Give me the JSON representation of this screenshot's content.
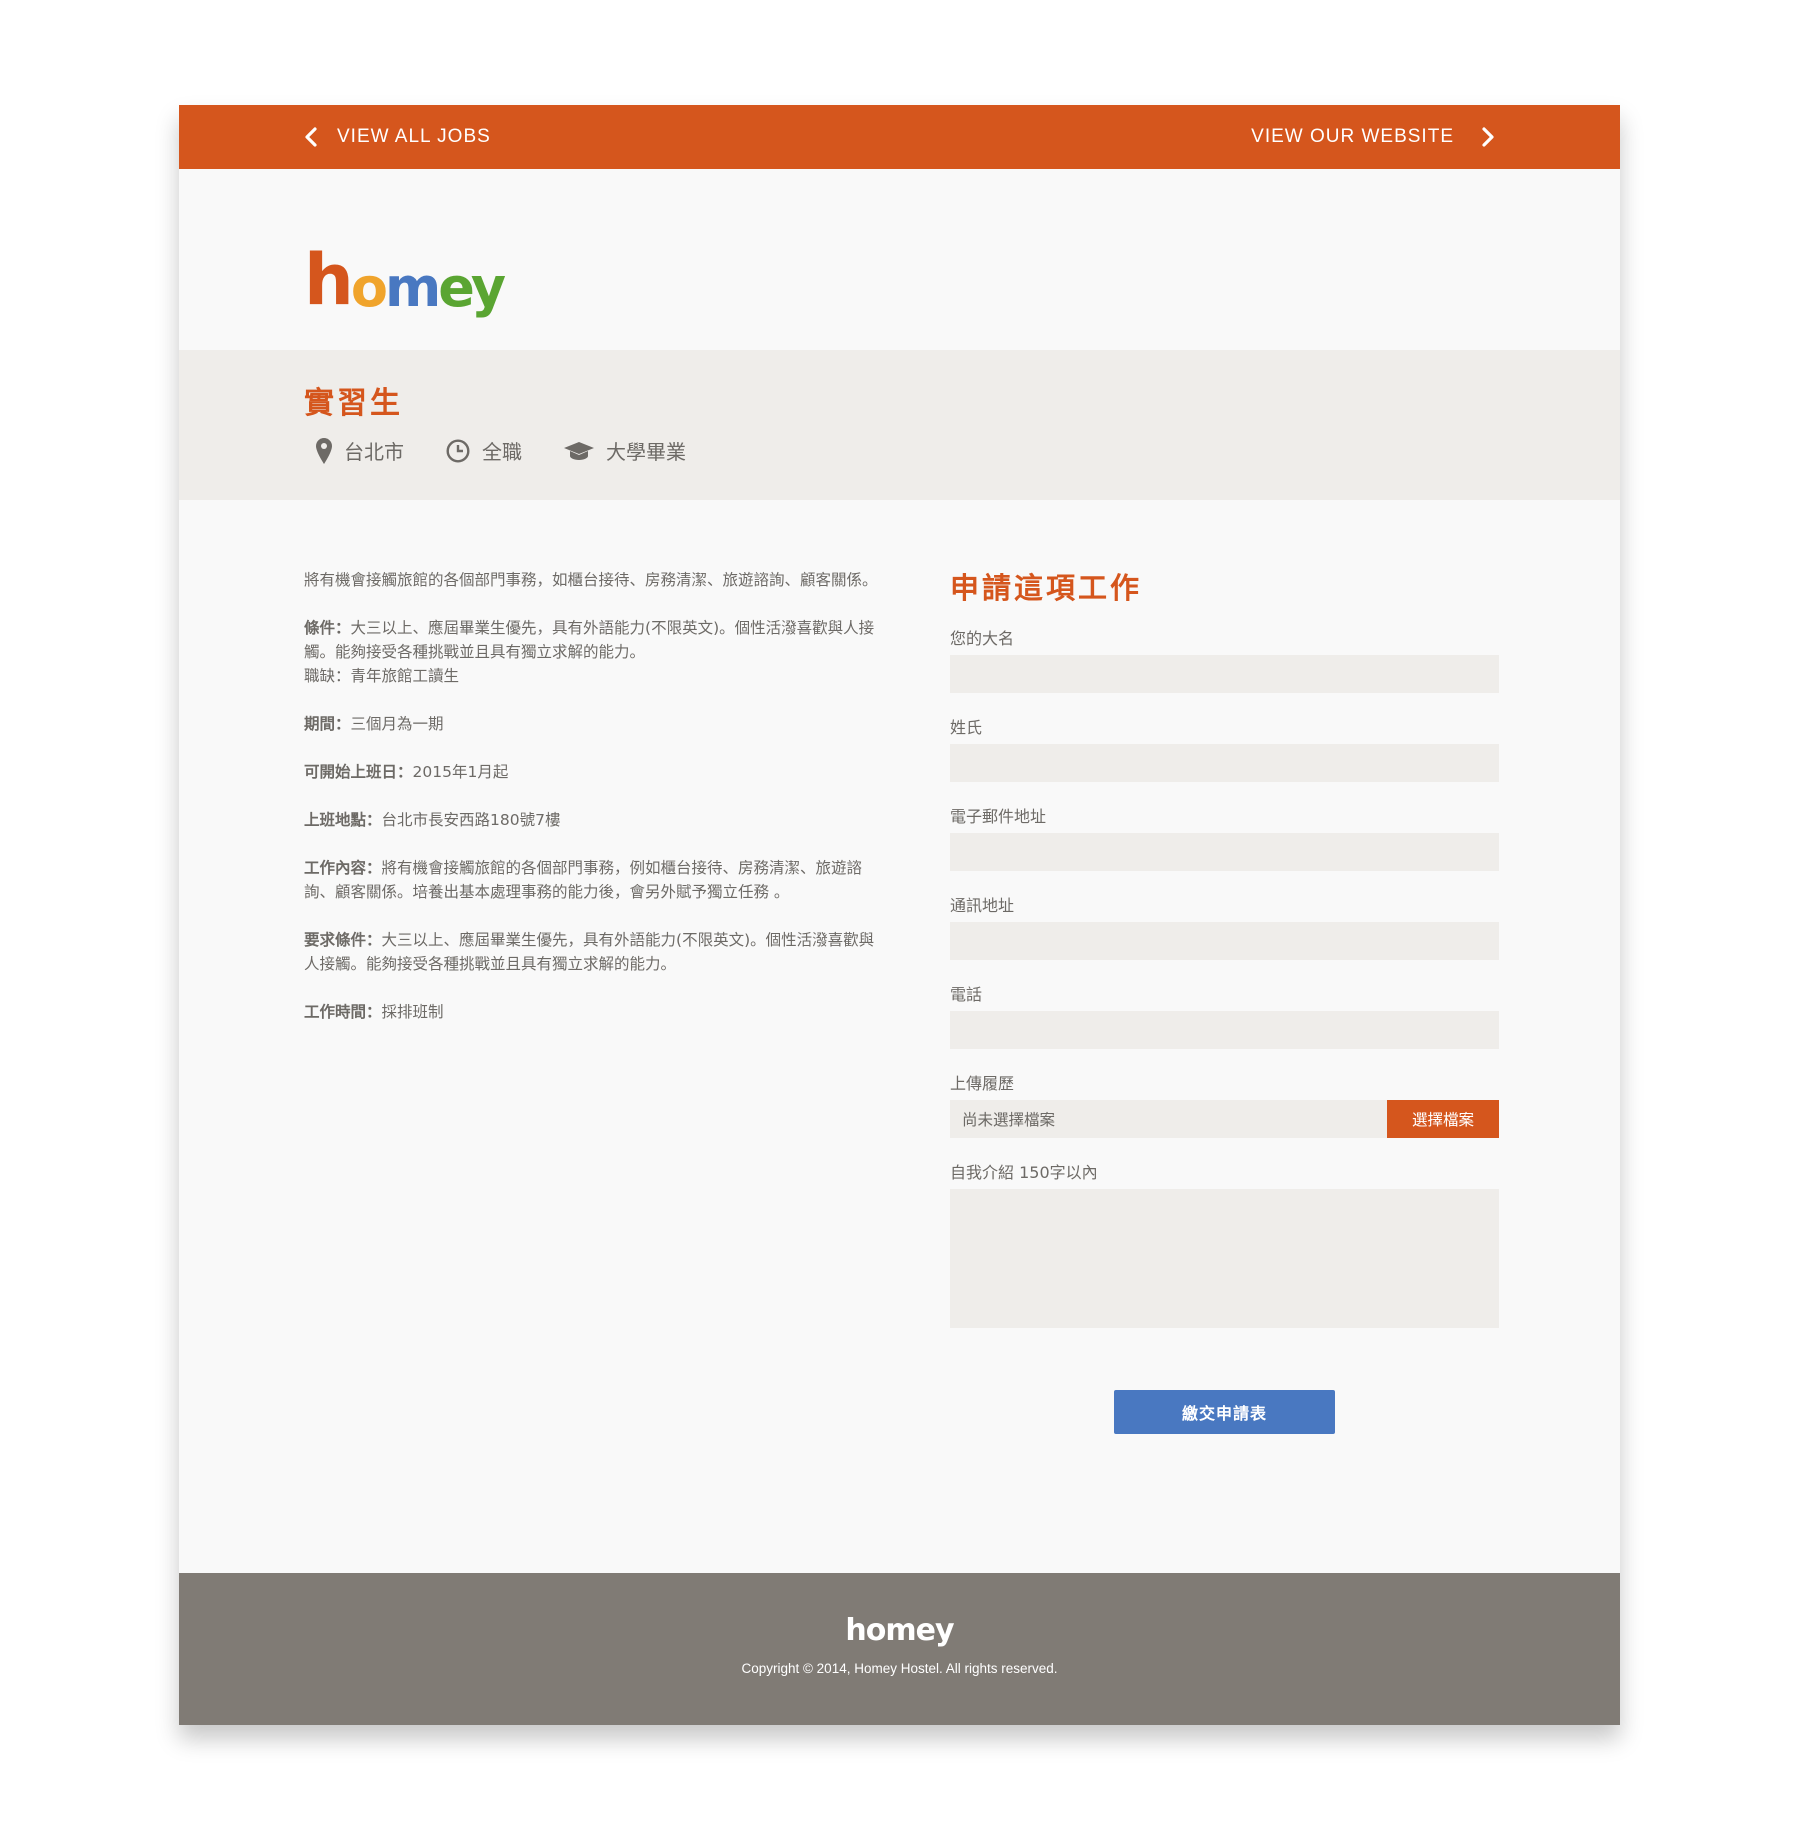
{
  "nav": {
    "back_label": "VIEW ALL JOBS",
    "website_label": "VIEW OUR WEBSITE"
  },
  "brand": {
    "name": "homey",
    "logo_letters": [
      "h",
      "o",
      "m",
      "e",
      "y"
    ],
    "colors": {
      "accent": "#d5561d",
      "blue": "#4978c1",
      "green": "#5aa532",
      "orange_o": "#f0a42c",
      "footer": "#807b75",
      "panel": "#efedea"
    }
  },
  "job": {
    "title": "實習生",
    "location": "台北市",
    "type": "全職",
    "education": "大學畢業",
    "location_icon": "map-pin-icon",
    "type_icon": "clock-icon",
    "education_icon": "graduation-cap-icon"
  },
  "description": {
    "intro": "將有機會接觸旅館的各個部門事務，如櫃台接待、房務清潔、旅遊諮詢、顧客關係。",
    "conditions_label": "條件：",
    "conditions": "大三以上、應屆畢業生優先，具有外語能力(不限英文)。個性活潑喜歡與人接觸。能夠接受各種挑戰並且具有獨立求解的能力。",
    "vacancy_label": "職缺：",
    "vacancy": "青年旅館工讀生",
    "period_label": "期間：",
    "period": "三個月為一期",
    "start_label": "可開始上班日：",
    "start": "2015年1月起",
    "place_label": "上班地點：",
    "place": "台北市長安西路180號7樓",
    "content_label": "工作內容：",
    "content": "將有機會接觸旅館的各個部門事務，例如櫃台接待、房務清潔、旅遊諮詢、顧客關係。培養出基本處理事務的能力後，會另外賦予獨立任務 。",
    "requirements_label": "要求條件：",
    "requirements": "大三以上、應屆畢業生優先，具有外語能力(不限英文)。個性活潑喜歡與人接觸。能夠接受各種挑戰並且具有獨立求解的能力。",
    "hours_label": "工作時間：",
    "hours": "採排班制"
  },
  "form": {
    "title": "申請這項工作",
    "first_name_label": "您的大名",
    "last_name_label": "姓氏",
    "email_label": "電子郵件地址",
    "address_label": "通訊地址",
    "phone_label": "電話",
    "resume_label": "上傳履歷",
    "resume_status": "尚未選擇檔案",
    "resume_button": "選擇檔案",
    "intro_label": "自我介紹 150字以內",
    "submit_label": "繳交申請表"
  },
  "footer": {
    "logo": "homey",
    "copyright": "Copyright © 2014, Homey Hostel. All rights reserved."
  }
}
